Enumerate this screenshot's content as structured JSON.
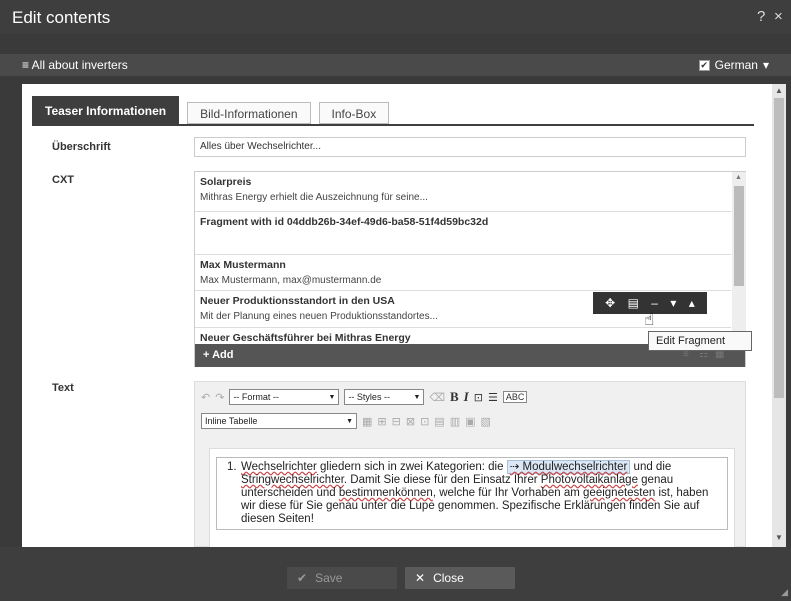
{
  "window": {
    "title": "Edit contents",
    "help_label": "?",
    "close_label": "×"
  },
  "subbar": {
    "menu_label": "≡ All about inverters",
    "language_checkbox": "✔",
    "language": "German",
    "language_arrow": "▾"
  },
  "tabs": [
    {
      "label": "Teaser Informationen"
    },
    {
      "label": "Bild-Informationen"
    },
    {
      "label": "Info-Box"
    }
  ],
  "fields": {
    "heading_label": "Überschrift",
    "heading_value": "Alles über Wechselrichter...",
    "cxt_label": "CXT",
    "text_label": "Text"
  },
  "cxt_items": [
    {
      "title": "Solarpreis",
      "subtitle": "Mithras Energy erhielt die Auszeichnung für seine..."
    },
    {
      "title": "Fragment with id 04ddb26b-34ef-49d6-ba58-51f4d59bc32d",
      "subtitle": ""
    },
    {
      "title": "Max Mustermann",
      "subtitle": "Max Mustermann, max@mustermann.de"
    },
    {
      "title": "Neuer Produktionsstandort in den USA",
      "subtitle": "Mit der Planung eines neuen Produktionsstandortes..."
    },
    {
      "title": "Neuer Geschäftsführer bei Mithras Energy",
      "subtitle": ""
    }
  ],
  "cxt_footer": {
    "add_label": "+ Add"
  },
  "fragment_toolbar": {
    "move_icon": "✥",
    "edit_icon": "▤",
    "remove_icon": "–",
    "down_icon": "▾",
    "up_icon": "▴"
  },
  "tooltip": "Edit Fragment",
  "editor": {
    "format_select": "-- Format --",
    "styles_select": "-- Styles --",
    "table_select": "Inline Tabelle",
    "bold": "B",
    "italic": "I",
    "list_number": "1.",
    "text_before_link1": "Wechselrichter",
    "text_1": " gliedern sich in zwei Kategorien: die ",
    "link_chip": "⇢ Modulwechselrichter",
    "text_2": " und die ",
    "text_stringwr": "Stringwechselrichter",
    "text_3": ". Damit Sie diese für den Einsatz Ihrer ",
    "text_pv": "Photovoltaikanlage",
    "text_4": " genau unterscheiden und ",
    "text_bestimmen": "bestimmenkönnen",
    "text_5": ", welche für Ihr Vorhaben am ",
    "text_geeignet": "geeignetesten",
    "text_6": " ist, haben wir diese für Sie genau unter die Lupe genommen. Spezifische Erklärungen finden Sie auf diesen Seiten!"
  },
  "footer": {
    "save_icon": "✔",
    "save_label": "Save",
    "close_icon": "✕",
    "close_label": "Close"
  }
}
